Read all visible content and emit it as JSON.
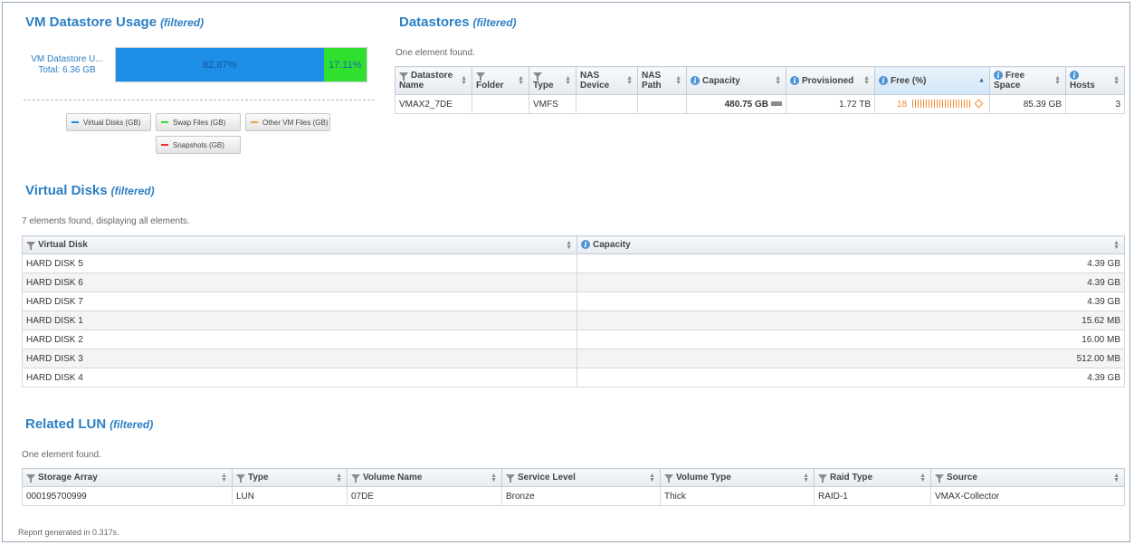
{
  "vm_usage": {
    "title": "VM Datastore Usage",
    "filtered": "(filtered)",
    "bar_label": "VM Datastore U...",
    "bar_total": "Total: 6.36 GB",
    "segments": [
      {
        "label": "82.87%",
        "percent": 82.87,
        "color": "#1e8ee6"
      },
      {
        "label": "17.11%",
        "percent": 17.11,
        "color": "#2fe02f"
      }
    ],
    "legend": [
      {
        "label": "Virtual Disks (GB)",
        "color": "#1e8ee6"
      },
      {
        "label": "Swap Files (GB)",
        "color": "#2fe02f"
      },
      {
        "label": "Other VM Files (GB)",
        "color": "#f0a050"
      },
      {
        "label": "Snapshots (GB)",
        "color": "#e03030"
      }
    ]
  },
  "datastores": {
    "title": "Datastores",
    "filtered": "(filtered)",
    "note": "One element found.",
    "headers": {
      "name": [
        "Datastore",
        "Name"
      ],
      "folder": "Folder",
      "type": "Type",
      "nas_device": [
        "NAS",
        "Device"
      ],
      "nas_path": [
        "NAS",
        "Path"
      ],
      "capacity": "Capacity",
      "provisioned": "Provisioned",
      "free_pct": "Free (%)",
      "free_space": [
        "Free",
        "Space"
      ],
      "hosts": "Hosts"
    },
    "row": {
      "name": "VMAX2_7DE",
      "folder": "",
      "type": "VMFS",
      "nas_device": "",
      "nas_path": "",
      "capacity": "480.75 GB",
      "provisioned": "1.72 TB",
      "free_pct": "18",
      "free_space": "85.39 GB",
      "hosts": "3"
    }
  },
  "virtual_disks": {
    "title": "Virtual Disks",
    "filtered": "(filtered)",
    "note": "7 elements found, displaying all elements.",
    "headers": {
      "disk": "Virtual Disk",
      "capacity": "Capacity"
    },
    "rows": [
      {
        "disk": "HARD DISK 5",
        "capacity": "4.39 GB"
      },
      {
        "disk": "HARD DISK 6",
        "capacity": "4.39 GB"
      },
      {
        "disk": "HARD DISK 7",
        "capacity": "4.39 GB"
      },
      {
        "disk": "HARD DISK 1",
        "capacity": "15.62 MB"
      },
      {
        "disk": "HARD DISK 2",
        "capacity": "16.00 MB"
      },
      {
        "disk": "HARD DISK 3",
        "capacity": "512.00 MB"
      },
      {
        "disk": "HARD DISK 4",
        "capacity": "4.39 GB"
      }
    ]
  },
  "related_lun": {
    "title": "Related LUN",
    "filtered": "(filtered)",
    "note": "One element found.",
    "headers": {
      "storage_array": "Storage Array",
      "type": "Type",
      "volume_name": "Volume Name",
      "service_level": "Service Level",
      "volume_type": "Volume Type",
      "raid_type": "Raid Type",
      "source": "Source"
    },
    "row": {
      "storage_array": "000195700999",
      "type": "LUN",
      "volume_name": "07DE",
      "service_level": "Bronze",
      "volume_type": "Thick",
      "raid_type": "RAID-1",
      "source": "VMAX-Collector"
    }
  },
  "footer": "Report generated in 0.317s."
}
